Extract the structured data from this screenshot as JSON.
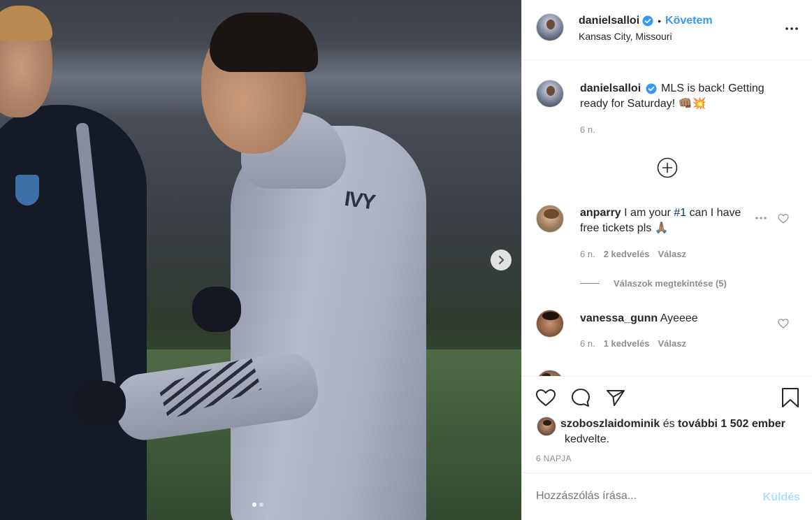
{
  "post": {
    "username": "danielsalloi",
    "follow_label": "Követem",
    "separator": "•",
    "location": "Kansas City, Missouri"
  },
  "media": {
    "jacket_text": "IVY",
    "slide_count": 2,
    "active_slide": 1
  },
  "caption": {
    "username": "danielsalloi",
    "text": "MLS is back! Getting ready for Saturday! 👊🏽💥",
    "time": "6 n."
  },
  "comments": [
    {
      "username": "anparry",
      "text_pre": "I am your ",
      "hashtag": "#1",
      "text_post": " can I have free tickets pls 🙏🏽",
      "time": "6 n.",
      "likes": "2 kedvelés",
      "reply": "Válasz",
      "view_replies": "Válaszok megtekintése (5)"
    },
    {
      "username": "vanessa_gunn",
      "text": "Ayeeee",
      "time": "6 n.",
      "likes": "1 kedvelés",
      "reply": "Válasz"
    }
  ],
  "likes": {
    "liker": "szoboszlaidominik",
    "and": " és ",
    "others": "további 1 502 ember",
    "suffix": "kedvelte."
  },
  "timestamp": "6 NAPJA",
  "comment_box": {
    "placeholder": "Hozzászólás írása...",
    "post_label": "Küldés"
  },
  "colors": {
    "accent": "#3897f0",
    "verified": "#3897f0",
    "muted": "#8e8e8e",
    "post_disabled": "#b2dffc"
  }
}
